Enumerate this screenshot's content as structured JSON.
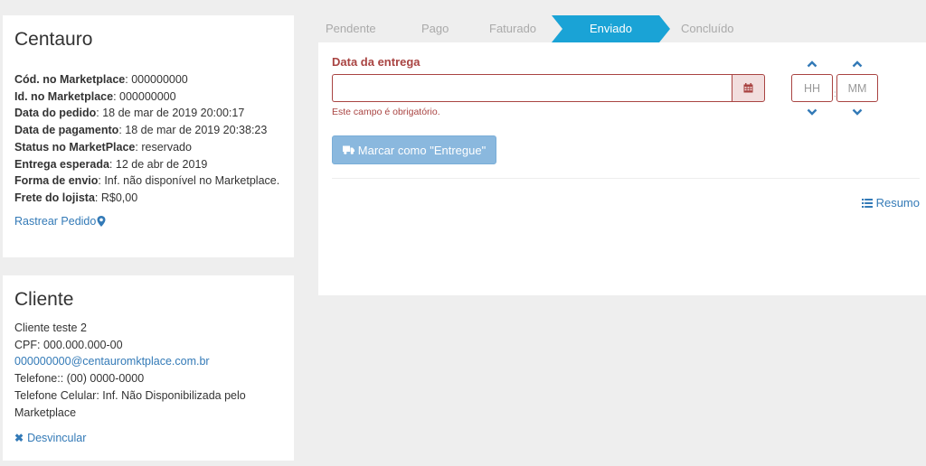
{
  "order": {
    "title": "Centauro",
    "fields": [
      {
        "label": "Cód. no Marketplace",
        "value": ": 000000000"
      },
      {
        "label": "Id. no Marketplace",
        "value": ": 000000000"
      },
      {
        "label": "Data do pedido",
        "value": ": 18 de mar de 2019 20:00:17"
      },
      {
        "label": "Data de pagamento",
        "value": ": 18 de mar de 2019 20:38:23"
      },
      {
        "label": "Status no MarketPlace",
        "value": ": reservado"
      },
      {
        "label": "Entrega esperada",
        "value": ": 12 de abr de 2019"
      },
      {
        "label": "Forma de envio",
        "value": ": Inf. não disponível no Marketplace."
      },
      {
        "label": "Frete do lojista",
        "value": ": R$0,00"
      }
    ],
    "track_link": "Rastrear Pedido"
  },
  "client": {
    "title": "Cliente",
    "name": "Cliente teste 2",
    "cpf": "CPF: 000.000.000-00",
    "email": "000000000@centauromktplace.com.br",
    "phone": "Telefone:: (00) 0000-0000",
    "mobile": "Telefone Celular: Inf. Não Disponibilizada pelo Marketplace",
    "unlink": "Desvincular"
  },
  "steps": [
    "Pendente",
    "Pago",
    "Faturado",
    "Enviado",
    "Concluído"
  ],
  "active_step": "Enviado",
  "delivery": {
    "label": "Data da entrega",
    "date_value": "",
    "error": "Este campo é obrigatório.",
    "hour_placeholder": "HH",
    "minute_placeholder": "MM",
    "time_separator": ":",
    "button": "Marcar como \"Entregue\""
  },
  "summary_link": "Resumo",
  "colors": {
    "accent": "#1aa3d6",
    "error": "#a94442",
    "link": "#337ab7",
    "button": "#8ab8de"
  }
}
